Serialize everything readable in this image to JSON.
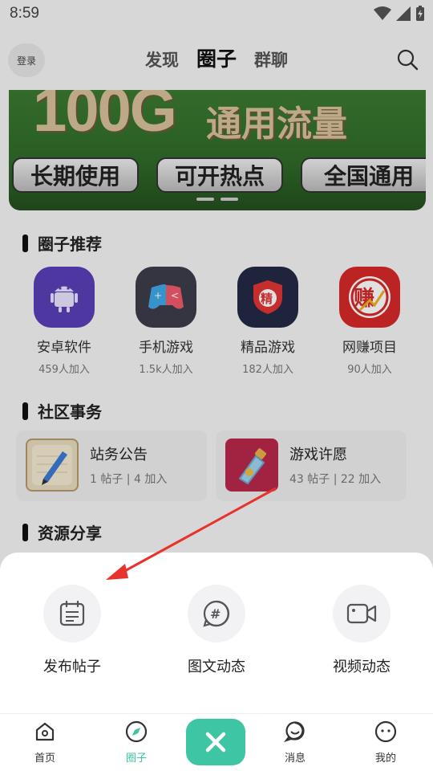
{
  "status": {
    "time": "8:59"
  },
  "header": {
    "login": "登录",
    "tabs": [
      {
        "label": "发现",
        "active": false
      },
      {
        "label": "圈子",
        "active": true
      },
      {
        "label": "群聊",
        "active": false
      }
    ]
  },
  "banner": {
    "headline": "100G",
    "subline": "通用流量",
    "chips": [
      "长期使用",
      "可开热点",
      "全国通用"
    ]
  },
  "recommend": {
    "title": "圈子推荐",
    "items": [
      {
        "name": "安卓软件",
        "count": "459人加入",
        "color": "#5b3fb8",
        "icon": "android-icon"
      },
      {
        "name": "手机游戏",
        "count": "1.5k人加入",
        "color": "#3d3d4a",
        "icon": "gamepad-icon"
      },
      {
        "name": "精品游戏",
        "count": "182人加入",
        "color": "#222a44",
        "icon": "shield-icon"
      },
      {
        "name": "网赚项目",
        "count": "90人加入",
        "color": "#d62828",
        "icon": "earn-icon"
      }
    ]
  },
  "community": {
    "title": "社区事务",
    "cards": [
      {
        "title": "站务公告",
        "posts": "1 帖子",
        "joins": "4 加入",
        "icon": "notepad-icon"
      },
      {
        "title": "游戏许愿",
        "posts": "43 帖子",
        "joins": "22 加入",
        "icon": "bottle-icon"
      }
    ]
  },
  "resources": {
    "title": "资源分享"
  },
  "sheet": {
    "actions": [
      {
        "label": "发布帖子",
        "icon": "post-icon"
      },
      {
        "label": "图文动态",
        "icon": "hashtag-icon"
      },
      {
        "label": "视频动态",
        "icon": "video-icon"
      }
    ]
  },
  "nav": {
    "items": [
      {
        "label": "首页",
        "icon": "home-icon"
      },
      {
        "label": "圈子",
        "icon": "compass-icon",
        "active": true
      },
      {
        "label": "消息",
        "icon": "message-icon"
      },
      {
        "label": "我的",
        "icon": "profile-icon"
      }
    ]
  },
  "colors": {
    "accent": "#3ec5a3",
    "arrow": "#e8322b"
  }
}
